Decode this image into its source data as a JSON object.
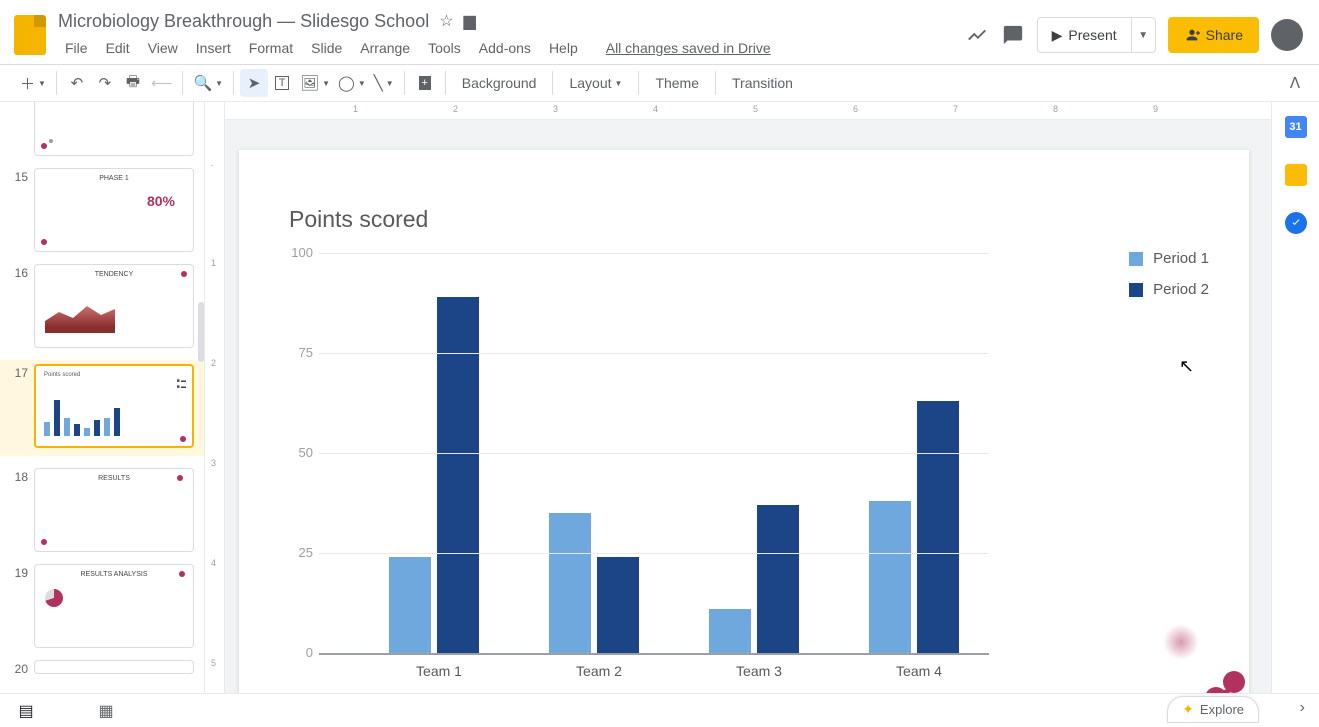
{
  "doc_title": "Microbiology Breakthrough — Slidesgo School",
  "menus": {
    "file": "File",
    "edit": "Edit",
    "view": "View",
    "insert": "Insert",
    "format": "Format",
    "slide": "Slide",
    "arrange": "Arrange",
    "tools": "Tools",
    "addons": "Add-ons",
    "help": "Help",
    "status": "All changes saved in Drive"
  },
  "header": {
    "present": "Present",
    "share": "Share"
  },
  "toolbar": {
    "background": "Background",
    "layout": "Layout",
    "theme": "Theme",
    "transition": "Transition"
  },
  "thumbs": {
    "numbers": [
      "15",
      "16",
      "17",
      "18",
      "19",
      "20"
    ],
    "titles": {
      "t15": "PHASE 1",
      "t15_pct": "80%",
      "t16": "TENDENCY",
      "t17": "Points scored",
      "t18": "RESULTS",
      "t19": "RESULTS ANALYSIS"
    }
  },
  "chart_data": {
    "type": "bar",
    "title": "Points scored",
    "categories": [
      "Team 1",
      "Team 2",
      "Team 3",
      "Team 4"
    ],
    "series": [
      {
        "name": "Period 1",
        "values": [
          24,
          35,
          11,
          38
        ],
        "color": "#6fa8dc"
      },
      {
        "name": "Period 2",
        "values": [
          89,
          24,
          37,
          63
        ],
        "color": "#1c4587"
      }
    ],
    "ylim": [
      0,
      100
    ],
    "yticks": [
      0,
      25,
      50,
      75,
      100
    ]
  },
  "sidepanel": {
    "cal": "31"
  },
  "explore": "Explore"
}
